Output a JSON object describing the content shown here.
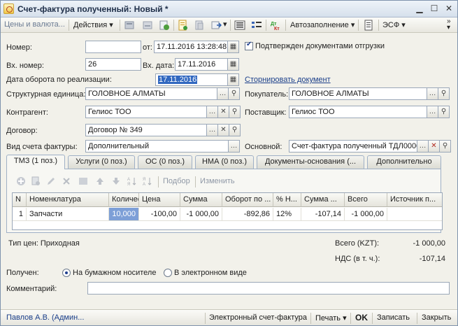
{
  "window": {
    "title": "Счет-фактура полученный: Новый *"
  },
  "toolbar": {
    "prices_label": "Цены и валюта...",
    "actions_label": "Действия",
    "autofill_label": "Автозаполнение",
    "esf_label": "ЭСФ",
    "dtkt_label": "Дт Кт"
  },
  "form": {
    "number": {
      "label": "Номер:",
      "value": ""
    },
    "from": {
      "label": "от:",
      "value": "17.11.2016 13:28:48"
    },
    "confirmed": {
      "label": "Подтвержден документами отгрузки",
      "checked": true
    },
    "incoming_number": {
      "label": "Вх. номер:",
      "value": "26"
    },
    "incoming_date": {
      "label": "Вх. дата:",
      "value": "17.11.2016"
    },
    "turnover_date": {
      "label": "Дата оборота по реализации:",
      "value": "17.11.2016"
    },
    "storno_link": "Сторнировать документ",
    "structural_unit": {
      "label": "Структурная единица:",
      "value": "ГОЛОВНОЕ АЛМАТЫ"
    },
    "buyer": {
      "label": "Покупатель:",
      "value": "ГОЛОВНОЕ АЛМАТЫ"
    },
    "counterparty": {
      "label": "Контрагент:",
      "value": "Гелиос ТОО"
    },
    "supplier": {
      "label": "Поставщик:",
      "value": "Гелиос ТОО"
    },
    "contract": {
      "label": "Договор:",
      "value": "Договор № 349"
    },
    "invoice_type": {
      "label": "Вид счета фактуры:",
      "value": "Дополнительный"
    },
    "basis": {
      "label": "Основной:",
      "value": "Счет-фактура полученный ТДЛ0000"
    }
  },
  "tabs": [
    {
      "label": "ТМЗ (1 поз.)"
    },
    {
      "label": "Услуги (0 поз.)"
    },
    {
      "label": "ОС (0 поз.)"
    },
    {
      "label": "НМА (0 поз.)"
    },
    {
      "label": "Документы-основания (..."
    },
    {
      "label": "Дополнительно"
    }
  ],
  "table_toolbar": {
    "selection_label": "Подбор",
    "edit_label": "Изменить"
  },
  "table": {
    "columns": [
      "N",
      "Номенклатура",
      "Количес...",
      "Цена",
      "Сумма",
      "Оборот по ...",
      "% Н...",
      "Сумма ...",
      "Всего",
      "Источник п..."
    ],
    "rows": [
      [
        "1",
        "Запчасти",
        "10,000",
        "-100,00",
        "-1 000,00",
        "-892,86",
        "12%",
        "-107,14",
        "-1 000,00",
        ""
      ]
    ]
  },
  "summary": {
    "price_type": "Тип цен: Приходная",
    "total_label": "Всего (KZT):",
    "total_value": "-1 000,00",
    "vat_label": "НДС (в т. ч.):",
    "vat_value": "-107,14"
  },
  "received": {
    "label": "Получен:",
    "options": [
      "На бумажном носителе",
      "В электронном виде"
    ],
    "selected": 0
  },
  "comment": {
    "label": "Комментарий:",
    "value": ""
  },
  "statusbar": {
    "user": "Павлов А.В. (Админ...",
    "electronic_invoice": "Электронный счет-фактура",
    "print": "Печать",
    "ok": "OK",
    "save": "Записать",
    "close": "Закрыть"
  }
}
